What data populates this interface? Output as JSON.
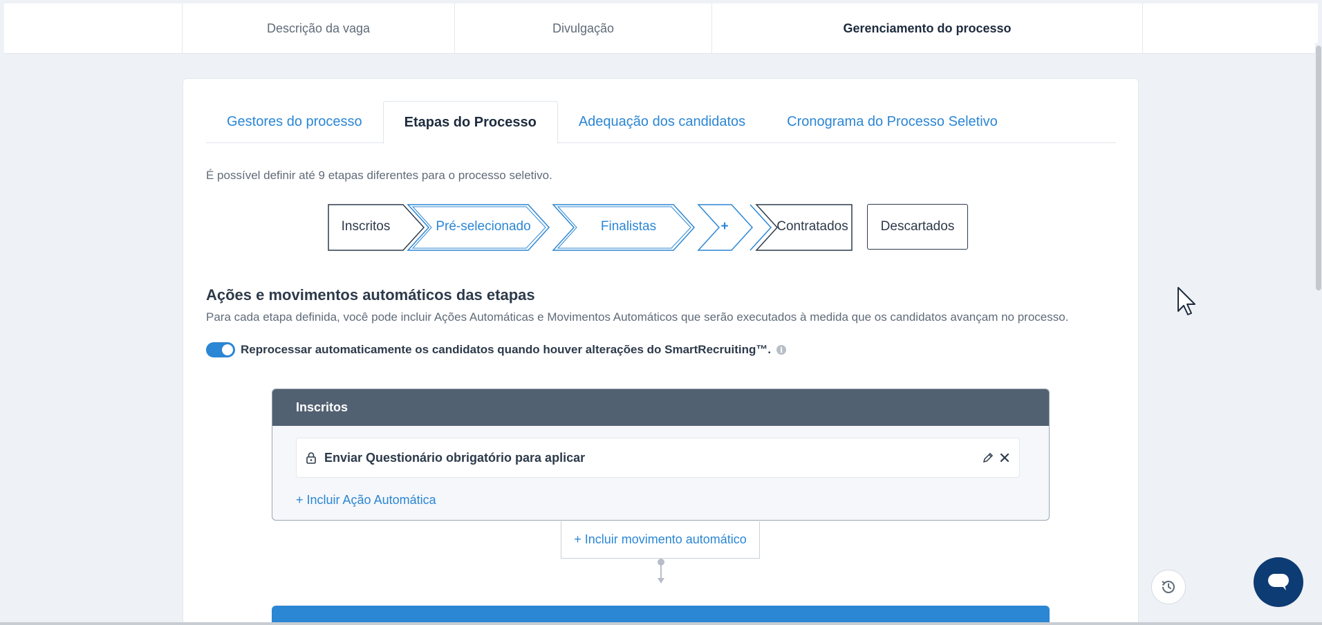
{
  "top_tabs": {
    "job_description": "Descrição da vaga",
    "publication": "Divulgação",
    "process_management": "Gerenciamento do processo"
  },
  "sub_tabs": {
    "managers": "Gestores do processo",
    "stages": "Etapas do Processo",
    "candidate_fit": "Adequação dos candidatos",
    "schedule": "Cronograma do Processo Seletivo"
  },
  "info_line": "É possível definir até 9 etapas diferentes para o processo seletivo.",
  "stages": {
    "inscritos": "Inscritos",
    "preselecionado": "Pré-selecionado",
    "finalistas": "Finalistas",
    "add": "+",
    "contratados": "Contratados",
    "descartados": "Descartados"
  },
  "automation": {
    "title": "Ações e movimentos automáticos das etapas",
    "description": "Para cada etapa definida, você pode incluir Ações Automáticas e Movimentos Automáticos que serão executados à medida que os candidatos avançam no processo.",
    "toggle_label": "Reprocessar automaticamente os candidatos quando houver alterações do SmartRecruiting™.",
    "toggle_on": true
  },
  "panel": {
    "header": "Inscritos",
    "action_text": "Enviar Questionário obrigatório para aplicar",
    "add_action": "+ Incluir Ação Automática",
    "add_movement": "+ Incluir movimento automático"
  },
  "icons": {
    "lock": "lock-icon",
    "edit": "pencil-icon",
    "remove": "close-icon",
    "history": "history-icon",
    "chat": "chat-icon",
    "info": "info-icon"
  },
  "colors": {
    "accent": "#2b86d4",
    "panel_header": "#526172",
    "chat_button": "#0d3b73"
  }
}
